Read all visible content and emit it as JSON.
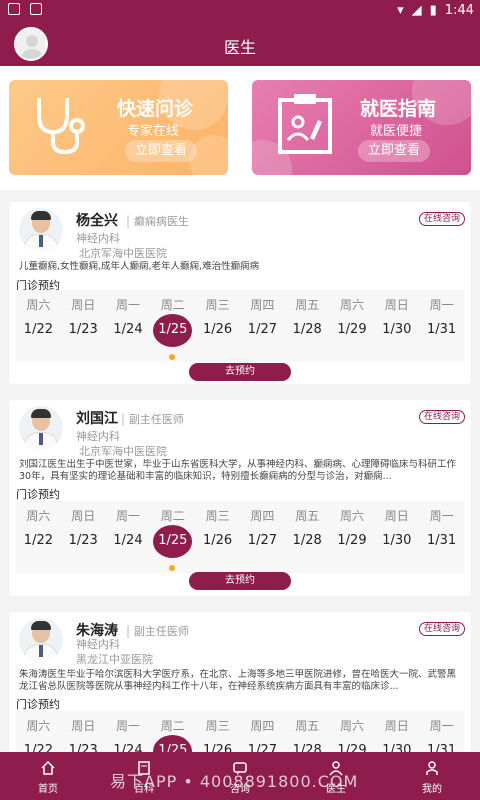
{
  "status": {
    "time": "1:44"
  },
  "header": {
    "title": "医生"
  },
  "banners": [
    {
      "title": "快速问诊",
      "subtitle": "专家在线",
      "button": "立即查看"
    },
    {
      "title": "就医指南",
      "subtitle": "就医便捷",
      "button": "立即查看"
    }
  ],
  "doctors": [
    {
      "name": "杨全兴",
      "title": "癫痫病医生",
      "dept": "神经内科",
      "hospital": "北京军海中医医院",
      "consult": "在线咨询",
      "desc": "儿童癫痫,女性癫痫,成年人癫痫,老年人癫痫,难治性癫痫病",
      "schedule_label": "门诊预约",
      "book": "去预约"
    },
    {
      "name": "刘国江",
      "title": "副主任医师",
      "dept": "神经内科",
      "hospital": "北京军海中医医院",
      "consult": "在线咨询",
      "desc": "刘国江医生出生于中医世家，毕业于山东省医科大学，从事神经内科、癫痫病、心理障碍临床与科研工作30年，具有坚实的理论基础和丰富的临床知识，特别擅长癫痫病的分型与诊治，对癫痫...",
      "schedule_label": "门诊预约",
      "book": "去预约"
    },
    {
      "name": "朱海涛",
      "title": "副主任医师",
      "dept": "神经内科",
      "hospital": "黑龙江中亚医院",
      "consult": "在线咨询",
      "desc": "朱海涛医生毕业于哈尔滨医科大学医疗系，在北京、上海等多地三甲医院进修，曾在哈医大一院、武警黑龙江省总队医院等医院从事神经内科工作十八年，在神经系统疾病方面具有丰富的临床诊...",
      "schedule_label": "门诊预约"
    }
  ],
  "week": {
    "days": [
      "周六",
      "周日",
      "周一",
      "周二",
      "周三",
      "周四",
      "周五",
      "周六",
      "周日",
      "周一"
    ],
    "dates": [
      "1/22",
      "1/23",
      "1/24",
      "1/25",
      "1/26",
      "1/27",
      "1/28",
      "1/29",
      "1/30",
      "1/31"
    ],
    "selected_index": 3
  },
  "tabs": [
    {
      "label": "首页",
      "icon": "home-icon"
    },
    {
      "label": "百科",
      "icon": "book-icon"
    },
    {
      "label": "咨询",
      "icon": "chat-icon"
    },
    {
      "label": "医生",
      "icon": "doctor-icon"
    },
    {
      "label": "我的",
      "icon": "user-icon"
    }
  ],
  "watermark": "易下APP • 4008891800.COM",
  "colors": {
    "primary": "#8e1c4c",
    "accent_dot": "#f5a623",
    "banner_orange": "#fdb366",
    "banner_pink": "#d0518e"
  }
}
